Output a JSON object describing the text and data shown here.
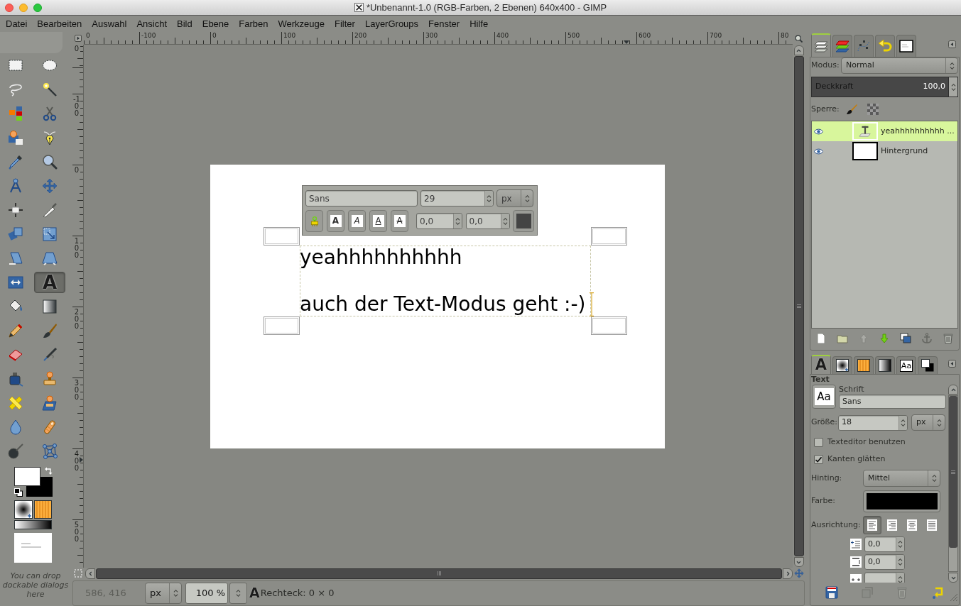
{
  "window": {
    "title": "*Unbenannt-1.0 (RGB-Farben, 2 Ebenen) 640x400 - GIMP"
  },
  "menu": [
    "Datei",
    "Bearbeiten",
    "Auswahl",
    "Ansicht",
    "Bild",
    "Ebene",
    "Farben",
    "Werkzeuge",
    "Filter",
    "LayerGroups",
    "Fenster",
    "Hilfe"
  ],
  "toolbox": {
    "tools": [
      {
        "kind": "rect",
        "selected": false
      },
      {
        "kind": "ellipse",
        "selected": false
      },
      {
        "kind": "lasso",
        "selected": false
      },
      {
        "kind": "wand",
        "selected": false
      },
      {
        "kind": "bycolor",
        "selected": false
      },
      {
        "kind": "scissors",
        "selected": false
      },
      {
        "kind": "foreground",
        "selected": false
      },
      {
        "kind": "paths",
        "selected": false
      },
      {
        "kind": "picker",
        "selected": false
      },
      {
        "kind": "zoom",
        "selected": false
      },
      {
        "kind": "measure",
        "selected": false
      },
      {
        "kind": "move",
        "selected": false
      },
      {
        "kind": "align",
        "selected": false
      },
      {
        "kind": "crop",
        "selected": false
      },
      {
        "kind": "rotate",
        "selected": false
      },
      {
        "kind": "scale",
        "selected": false
      },
      {
        "kind": "shear",
        "selected": false
      },
      {
        "kind": "perspective",
        "selected": false
      },
      {
        "kind": "flip",
        "selected": false
      },
      {
        "kind": "text",
        "glyph": "A",
        "selected": true
      },
      {
        "kind": "bucket",
        "selected": false
      },
      {
        "kind": "blend",
        "selected": false
      },
      {
        "kind": "pencil",
        "selected": false
      },
      {
        "kind": "brush",
        "selected": false
      },
      {
        "kind": "eraser",
        "selected": false
      },
      {
        "kind": "airbrush",
        "selected": false
      },
      {
        "kind": "ink",
        "selected": false
      },
      {
        "kind": "clone",
        "selected": false
      },
      {
        "kind": "heal",
        "selected": false
      },
      {
        "kind": "perspclone",
        "selected": false
      },
      {
        "kind": "blur",
        "selected": false
      },
      {
        "kind": "smudge",
        "selected": false
      },
      {
        "kind": "dodge",
        "selected": false
      },
      {
        "kind": "cage",
        "selected": false
      }
    ],
    "colors": [
      {
        "kind": "foreground",
        "color": "#ffffff"
      },
      {
        "kind": "background",
        "color": "#000000"
      }
    ],
    "drop_hint": "You can drop dockable dialogs here"
  },
  "image_window": {
    "rulers": {
      "horizontal": [
        "0",
        "-100",
        "0",
        "100",
        "200",
        "300",
        "400",
        "500",
        "600",
        "700",
        "80"
      ],
      "vertical": [
        "0",
        "-100",
        "0",
        "100",
        "200",
        "300",
        "400",
        "500"
      ]
    },
    "text_toolbar": {
      "font": "Sans",
      "size": "29",
      "unit": "px",
      "styles": [
        {
          "kind": "clear"
        },
        {
          "kind": "bold",
          "glyph": "A"
        },
        {
          "kind": "italic",
          "glyph": "A"
        },
        {
          "kind": "underline",
          "glyph": "A"
        },
        {
          "kind": "strike",
          "glyph": "A"
        }
      ],
      "baseline": "0,0",
      "kerning": "0,0",
      "color": "#444444"
    },
    "text_layer": {
      "lines": [
        "yeahhhhhhhhhh",
        "auch der Text-Modus geht :-)"
      ]
    },
    "status_bar": {
      "coordinates": "586, 416",
      "unit": "px",
      "zoom": "100 %",
      "tool_glyph": "A",
      "message": "Rechteck: 0 × 0"
    }
  },
  "layers_dock": {
    "tabs": [
      {
        "kind": "layers",
        "selected": true
      },
      {
        "kind": "channels",
        "selected": false
      },
      {
        "kind": "paths",
        "selected": false
      },
      {
        "kind": "undo",
        "selected": false
      },
      {
        "kind": "image",
        "selected": false
      }
    ],
    "mode_label": "Modus:",
    "mode": "Normal",
    "opacity": {
      "label": "Deckkraft",
      "value": "100,0",
      "level": 1
    },
    "lock_label": "Sperre:",
    "layers": [
      {
        "name": "yeahhhhhhhhhh ...",
        "kind": "text",
        "visible": true,
        "selected": true
      },
      {
        "name": "Hintergrund",
        "kind": "image",
        "visible": true,
        "selected": false
      }
    ],
    "buttons": [
      {
        "kind": "new",
        "disabled": false
      },
      {
        "kind": "group",
        "disabled": false
      },
      {
        "kind": "raise",
        "disabled": true
      },
      {
        "kind": "lower",
        "disabled": false
      },
      {
        "kind": "duplicate",
        "disabled": false
      },
      {
        "kind": "anchor",
        "disabled": true
      },
      {
        "kind": "delete",
        "disabled": false
      }
    ]
  },
  "tool_options": {
    "tabs": [
      {
        "kind": "tool",
        "glyph": "A",
        "selected": true
      },
      {
        "kind": "brushes",
        "selected": false
      },
      {
        "kind": "patterns",
        "selected": false
      },
      {
        "kind": "gradients",
        "selected": false
      },
      {
        "kind": "fonts",
        "glyph": "Aa",
        "selected": false
      },
      {
        "kind": "colors",
        "selected": false
      }
    ],
    "title": "Text",
    "font_label": "Schrift",
    "font_preview": "Aa",
    "font": "Sans",
    "size_label": "Größe:",
    "size": "18",
    "unit": "px",
    "checkboxes": [
      {
        "label": "Texteditor benutzen",
        "checked": false
      },
      {
        "label": "Kanten glätten",
        "checked": true
      }
    ],
    "hinting_label": "Hinting:",
    "hinting": "Mittel",
    "color_label": "Farbe:",
    "color": "#000000",
    "justify_label": "Ausrichtung:",
    "justify": [
      {
        "kind": "left",
        "selected": true
      },
      {
        "kind": "right",
        "selected": false
      },
      {
        "kind": "center",
        "selected": false
      },
      {
        "kind": "fill",
        "selected": false
      }
    ],
    "spacing": [
      {
        "kind": "indent",
        "value": "0,0"
      },
      {
        "kind": "line",
        "value": "0,0"
      },
      {
        "kind": "letter"
      }
    ],
    "buttons": [
      {
        "kind": "save",
        "disabled": false
      },
      {
        "kind": "restore",
        "disabled": true
      },
      {
        "kind": "delete",
        "disabled": true
      },
      {
        "kind": "reset",
        "disabled": false
      }
    ]
  }
}
